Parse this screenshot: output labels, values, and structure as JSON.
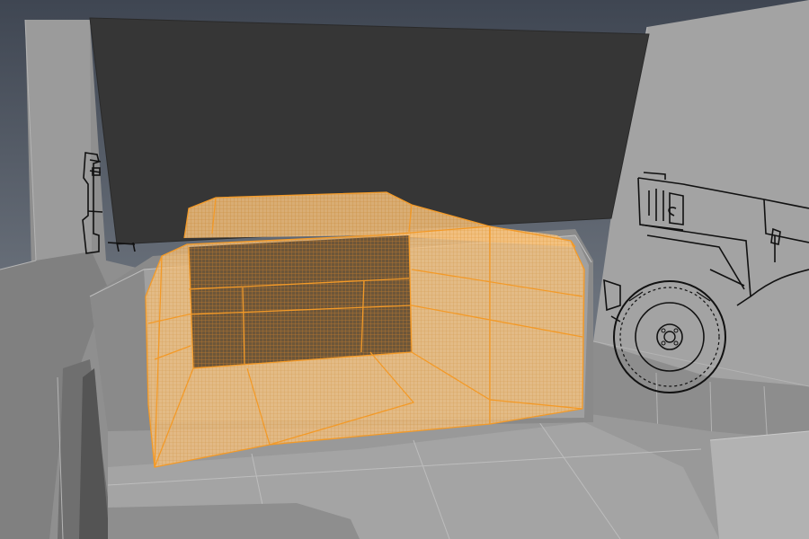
{
  "viewport": {
    "type": "3d-modeling-viewport",
    "view": "perspective",
    "shading": "flat-gray",
    "selected_object": "interior-cargo-box",
    "colors": {
      "background_top": "#3f4652",
      "background_bottom": "#7a8089",
      "mesh_gray": "#979797",
      "mesh_edges": "#b7b7b7",
      "backface_dark": "#353535",
      "selection_orange": "#f5a030",
      "selection_fill": "#f3c07a",
      "reference_lines": "#111111"
    },
    "icons": [
      "vehicle-blueprint-reference-left",
      "vehicle-blueprint-reference-right",
      "wheel-reference"
    ]
  }
}
